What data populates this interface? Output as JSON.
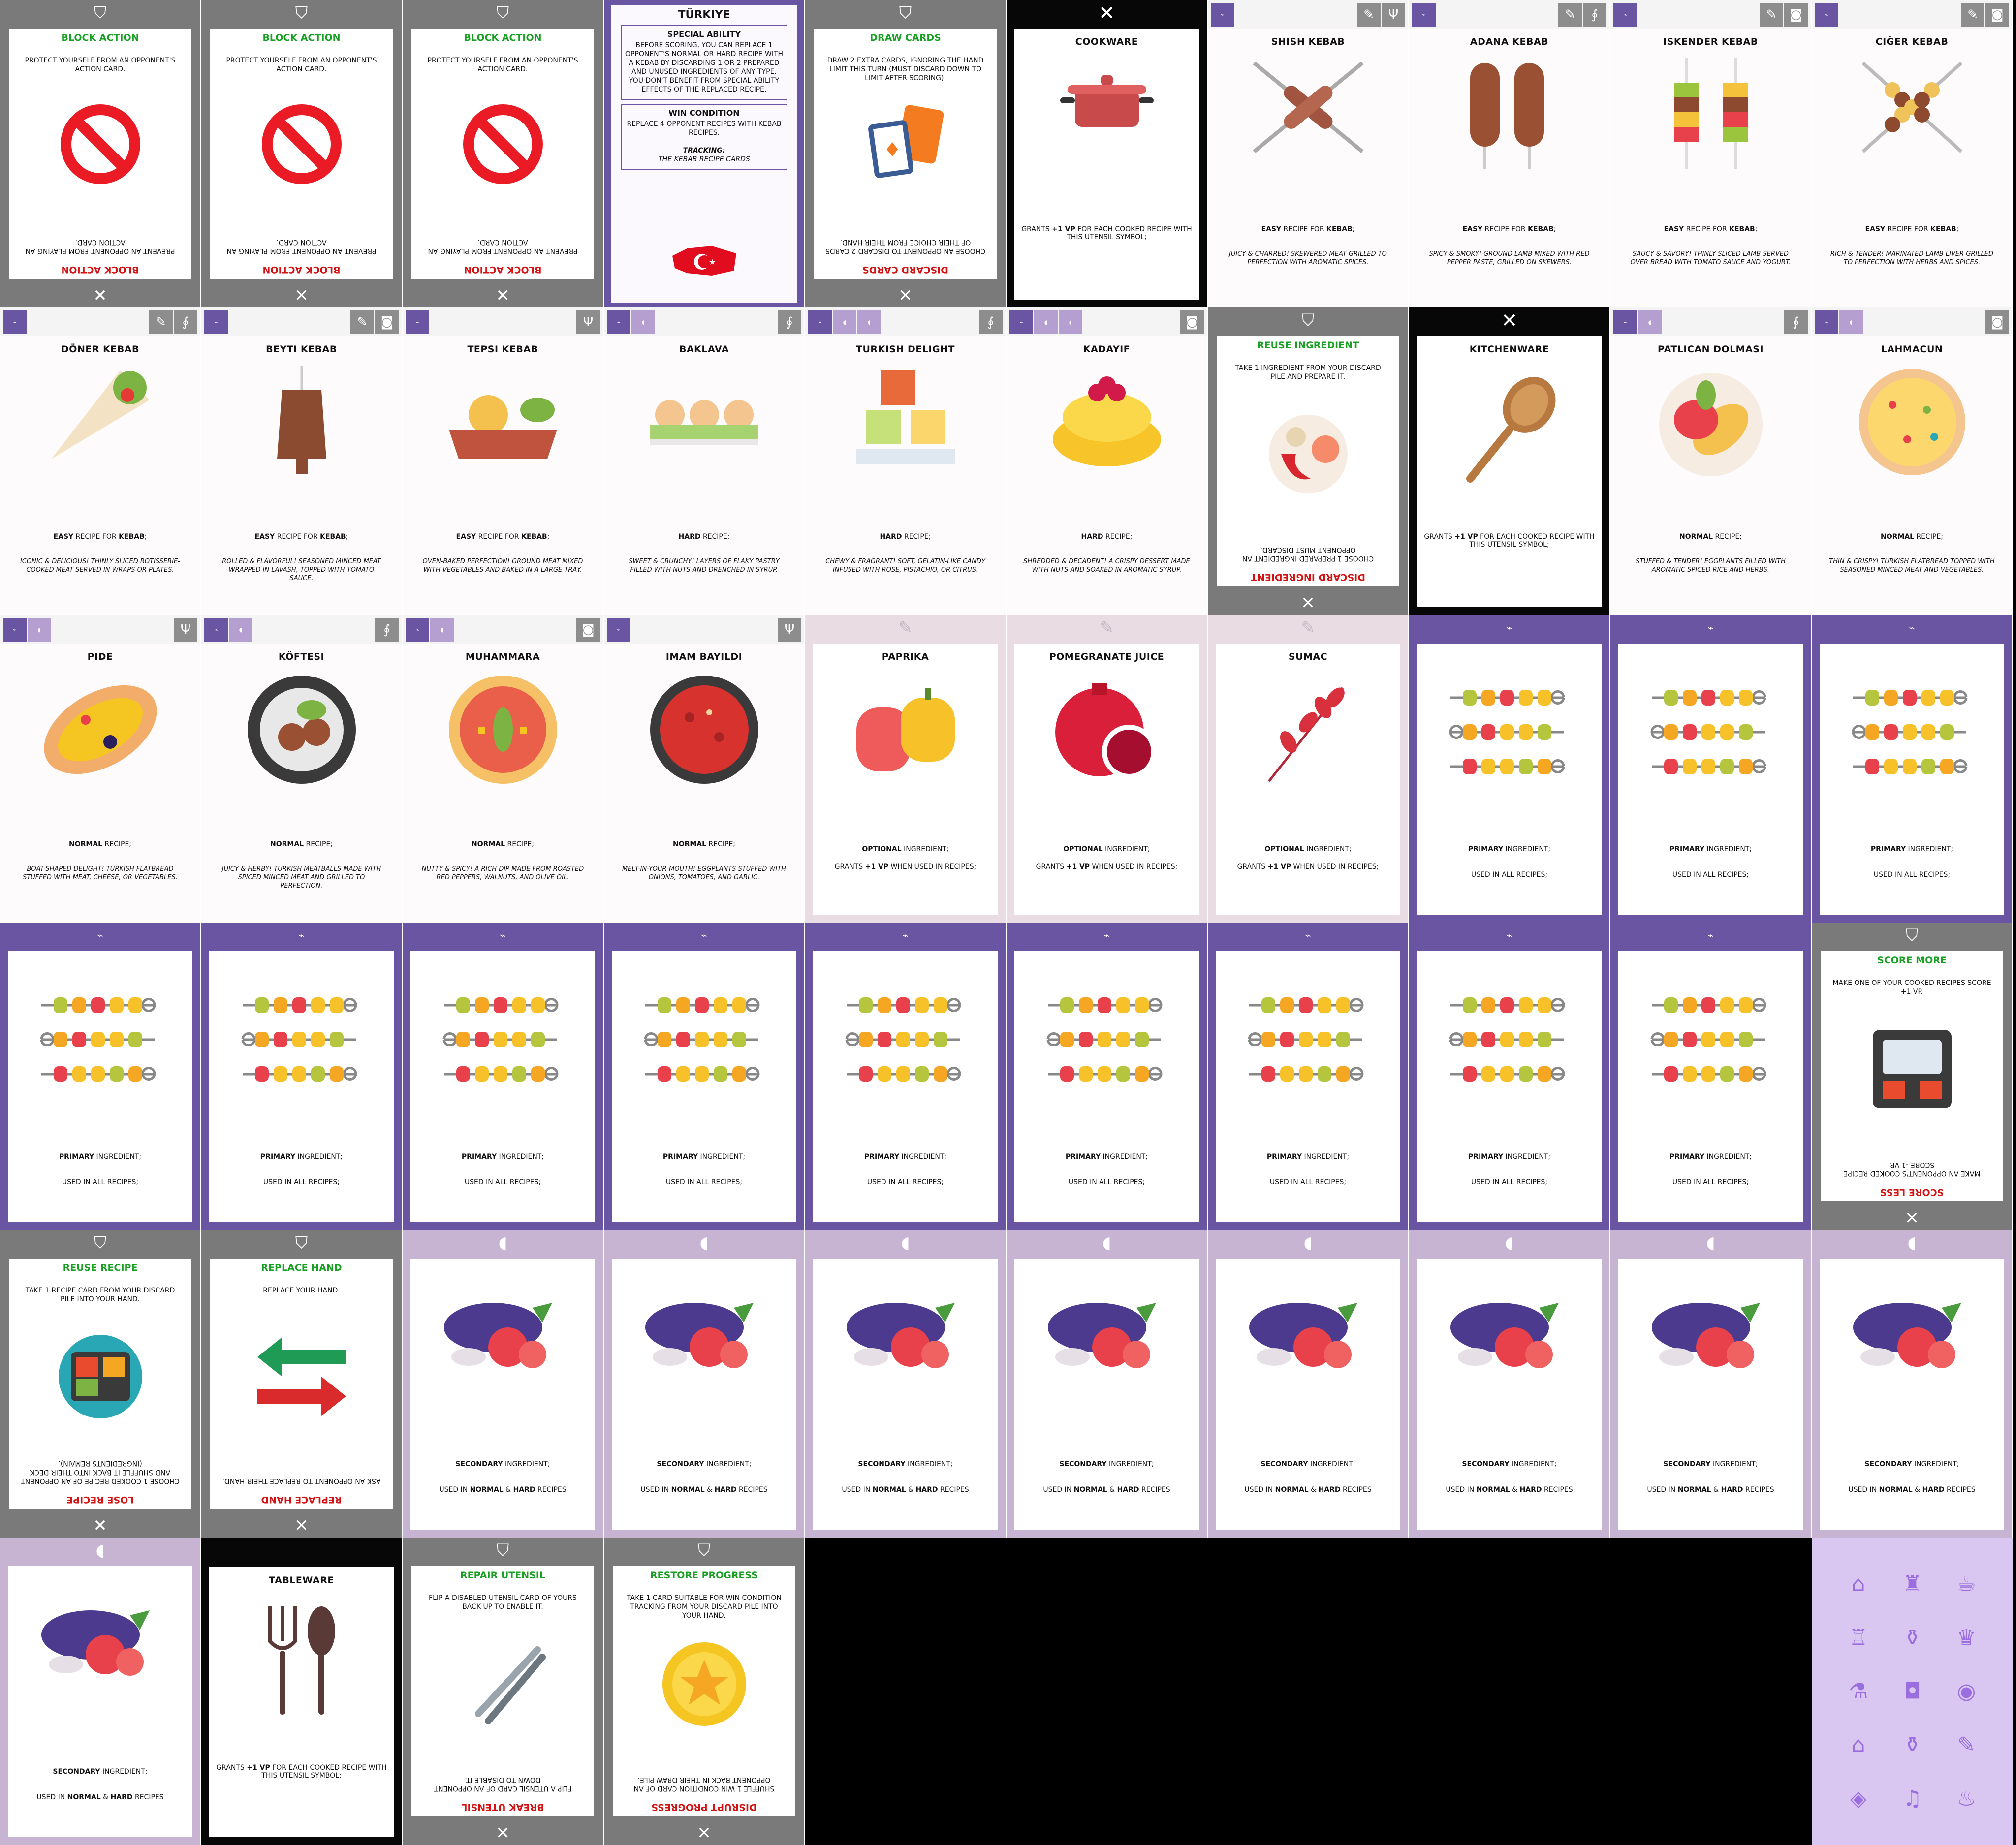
{
  "colors": {
    "action": "#7a7a7a",
    "primary": "#6a55a3",
    "secondary": "#c7b3d2",
    "optional": "#e9dde3",
    "utensil": "#070707",
    "green_title": "#17a022",
    "red_title": "#d31313",
    "card_back": "#d9c6f1"
  },
  "icons": {
    "action_emblem": "shield-icon",
    "utensil_emblem": "fork-knife-icon",
    "recipe_tag": "kebab-tag-icon",
    "secondary_tag": "eggplant-icon",
    "cookware_tag": "pot-icon",
    "kitchenware_tag": "spoon-icon",
    "tableware_tag": "fork-spoon-icon",
    "optional_tag": "paprika-icon"
  },
  "common": {
    "easy_kebab_pre": "EASY",
    "easy_kebab_mid": " RECIPE FOR ",
    "easy_kebab_word": "KEBAB",
    "easy_kebab_post": ";",
    "normal_word": "NORMAL",
    "recipe_suffix": " RECIPE;",
    "hard_word": "HARD",
    "primary_word": "PRIMARY",
    "ingredient_suffix": " INGREDIENT;",
    "used_all": "USED IN ALL RECIPES;",
    "secondary_word": "SECONDARY",
    "used_in": "USED IN ",
    "and": " & ",
    "recipes": " RECIPES",
    "optional_word": "OPTIONAL",
    "grants_pre": "GRANTS ",
    "vp_word": "+1 VP",
    "optional_post": " WHEN USED IN RECIPES;",
    "utensil_post": " FOR EACH COOKED RECIPE WITH THIS UTENSIL SYMBOL;"
  },
  "actions": {
    "block": {
      "title": "BLOCK ACTION",
      "text": "PROTECT YOURSELF FROM AN OPPONENT'S ACTION CARD.",
      "down_title": "BLOCK ACTION",
      "down_text": "PREVENT AN OPPONENT FROM PLAYING AN ACTION CARD."
    },
    "draw": {
      "title": "DRAW CARDS",
      "text": "DRAW 2 EXTRA CARDS, IGNORING THE HAND LIMIT THIS TURN (MUST DISCARD DOWN TO LIMIT AFTER SCORING).",
      "down_title": "DISCARD CARDS",
      "down_text": "CHOOSE AN OPPONENT TO DISCARD 2 CARDS OF THEIR CHOICE FROM THEIR HAND."
    },
    "reuse_ing": {
      "title": "REUSE INGREDIENT",
      "text": "TAKE 1 INGREDIENT FROM YOUR DISCARD PILE AND PREPARE IT.",
      "down_title": "DISCARD INGREDIENT",
      "down_text": "CHOOSE 1 PREPARED INGREDIENT AN OPPONENT MUST DISCARD."
    },
    "score_more": {
      "title": "SCORE MORE",
      "text": "MAKE ONE OF YOUR COOKED RECIPES SCORE +1 VP.",
      "down_title": "SCORE LESS",
      "down_text": "MAKE AN OPPONENT'S COOKED RECIPE SCORE -1 VP."
    },
    "reuse_recipe": {
      "title": "REUSE RECIPE",
      "text": "TAKE 1 RECIPE CARD FROM YOUR DISCARD PILE INTO YOUR HAND.",
      "down_title": "LOSE RECIPE",
      "down_text": "CHOOSE 1 COOKED RECIPE OF AN OPPONENT AND SHUFFLE IT BACK INTO THEIR DECK (INGREDIENTS REMAIN)."
    },
    "replace_hand": {
      "title": "REPLACE HAND",
      "text": "REPLACE YOUR HAND.",
      "down_title": "REPLACE HAND",
      "down_text": "ASK AN OPPONENT TO REPLACE THEIR HAND."
    },
    "repair": {
      "title": "REPAIR UTENSIL",
      "text": "FLIP A DISABLED UTENSIL CARD OF YOURS BACK UP TO ENABLE IT.",
      "down_title": "BREAK UTENSIL",
      "down_text": "FLIP A UTENSIL CARD OF AN OPPONENT DOWN TO DISABLE IT."
    },
    "restore": {
      "title": "RESTORE PROGRESS",
      "text": "TAKE 1 CARD SUITABLE FOR WIN CONDITION TRACKING FROM YOUR DISCARD PILE INTO YOUR HAND.",
      "down_title": "DISRUPT PROGRESS",
      "down_text": "SHUFFLE 1 WIN CONDITION CARD OF AN OPPONENT BACK IN THEIR DRAW PILE."
    }
  },
  "wincon": {
    "title": "TÜRKIYE",
    "special_heading": "SPECIAL ABILITY",
    "special_text": "BEFORE SCORING, YOU CAN REPLACE 1 OPPONENT'S NORMAL OR HARD RECIPE WITH A KEBAB BY DISCARDING 1 OR 2 PREPARED AND UNUSED INGREDIENTS OF ANY TYPE. YOU DON'T BENEFIT FROM SPECIAL ABILITY EFFECTS OF THE REPLACED RECIPE.",
    "win_heading": "WIN CONDITION",
    "win_text": "REPLACE 4 OPPONENT RECIPES WITH KEBAB RECIPES.",
    "tracking_label": "TRACKING:",
    "tracking_text": "THE KEBAB RECIPE CARDS"
  },
  "utensils": {
    "cookware": "COOKWARE",
    "kitchenware": "KITCHENWARE",
    "tableware": "TABLEWARE"
  },
  "recipes": {
    "shish": {
      "name": "SHISH KEBAB",
      "flavor": "JUICY & CHARRED! SKEWERED MEAT GRILLED TO PERFECTION WITH AROMATIC SPICES."
    },
    "adana": {
      "name": "ADANA KEBAB",
      "flavor": "SPICY & SMOKY! GROUND LAMB MIXED WITH RED PEPPER PASTE, GRILLED ON SKEWERS."
    },
    "iskender": {
      "name": "ISKENDER KEBAB",
      "flavor": "SAUCY & SAVORY! THINLY SLICED LAMB SERVED OVER BREAD WITH TOMATO SAUCE AND YOGURT."
    },
    "ciger": {
      "name": "CIĞER KEBAB",
      "flavor": "RICH & TENDER! MARINATED LAMB LIVER GRILLED TO PERFECTION WITH HERBS AND SPICES."
    },
    "doner": {
      "name": "DÖNER KEBAB",
      "flavor": "ICONIC & DELICIOUS! THINLY SLICED ROTISSERIE-COOKED MEAT SERVED IN WRAPS OR PLATES."
    },
    "beyti": {
      "name": "BEYTI KEBAB",
      "flavor": "ROLLED & FLAVORFUL! SEASONED MINCED MEAT WRAPPED IN LAVASH, TOPPED WITH TOMATO SAUCE."
    },
    "tepsi": {
      "name": "TEPSI KEBAB",
      "flavor": "OVEN-BAKED PERFECTION! GROUND MEAT MIXED WITH VEGETABLES AND BAKED IN A LARGE TRAY."
    },
    "baklava": {
      "name": "BAKLAVA",
      "flavor": "SWEET & CRUNCHY! LAYERS OF FLAKY PASTRY FILLED WITH NUTS AND DRENCHED IN SYRUP."
    },
    "delight": {
      "name": "TURKISH DELIGHT",
      "flavor": "CHEWY & FRAGRANT! SOFT, GELATIN-LIKE CANDY INFUSED WITH ROSE, PISTACHIO, OR CITRUS."
    },
    "kadayif": {
      "name": "KADAYIF",
      "flavor": "SHREDDED & DECADENT! A CRISPY DESSERT MADE WITH NUTS AND SOAKED IN AROMATIC SYRUP."
    },
    "dolmasi": {
      "name": "PATLICAN DOLMASI",
      "flavor": "STUFFED & TENDER! EGGPLANTS FILLED WITH AROMATIC SPICED RICE AND HERBS."
    },
    "lahmacun": {
      "name": "LAHMACUN",
      "flavor": "THIN & CRISPY! TURKISH FLATBREAD TOPPED WITH SEASONED MINCED MEAT AND VEGETABLES."
    },
    "pide": {
      "name": "PIDE",
      "flavor": "BOAT-SHAPED DELIGHT! TURKISH FLATBREAD STUFFED WITH MEAT, CHEESE, OR VEGETABLES."
    },
    "kofte": {
      "name": "KÖFTESI",
      "flavor": "JUICY & HERBY! TURKISH MEATBALLS MADE WITH SPICED MINCED MEAT AND GRILLED TO PERFECTION."
    },
    "muhammara": {
      "name": "MUHAMMARA",
      "flavor": "NUTTY & SPICY! A RICH DIP MADE FROM ROASTED RED PEPPERS, WALNUTS, AND OLIVE OIL."
    },
    "imam": {
      "name": "IMAM BAYILDI",
      "flavor": "MELT-IN-YOUR-MOUTH! EGGPLANTS STUFFED WITH ONIONS, TOMATOES, AND GARLIC."
    }
  },
  "optionals": {
    "paprika": "PAPRIKA",
    "juice": "POMEGRANATE JUICE",
    "sumac": "SUMAC"
  }
}
